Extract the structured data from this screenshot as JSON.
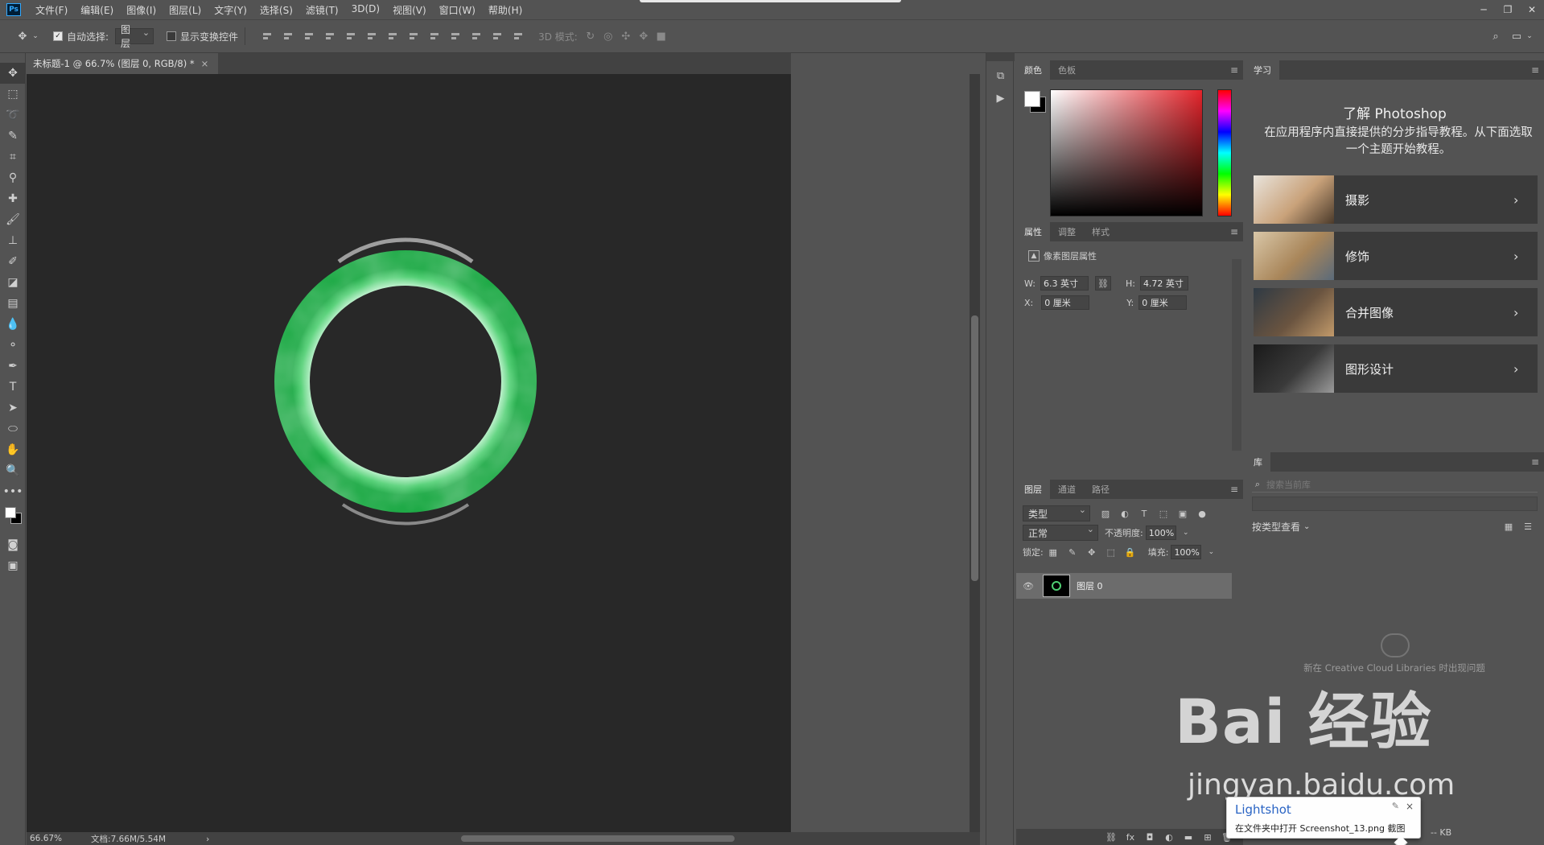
{
  "app": {
    "logo": "Ps"
  },
  "menu": [
    "文件(F)",
    "编辑(E)",
    "图像(I)",
    "图层(L)",
    "文字(Y)",
    "选择(S)",
    "滤镜(T)",
    "3D(D)",
    "视图(V)",
    "窗口(W)",
    "帮助(H)"
  ],
  "options": {
    "auto_select_label": "自动选择:",
    "auto_select_value": "图层",
    "show_transform_label": "显示变换控件",
    "mode_3d_label": "3D 模式:"
  },
  "document": {
    "tab_title": "未标题-1 @ 66.7% (图层 0, RGB/8) *",
    "close_glyph": "×",
    "zoom": "66.67%",
    "doc_info": "文档:7.66M/5.54M",
    "ring_colors": {
      "base": "#4fcf72",
      "light": "#cdf7da",
      "dark": "#1faa47"
    }
  },
  "color_panel": {
    "tabs": [
      "颜色",
      "色板"
    ],
    "fg": "#ffffff",
    "bg": "#000000",
    "hue": "#e3242b"
  },
  "properties_panel": {
    "tabs": [
      "属性",
      "调整",
      "样式"
    ],
    "header": "像素图层属性",
    "w_label": "W:",
    "w_value": "6.3 英寸",
    "h_label": "H:",
    "h_value": "4.72 英寸",
    "x_label": "X:",
    "x_value": "0 厘米",
    "y_label": "Y:",
    "y_value": "0 厘米"
  },
  "layers_panel": {
    "tabs": [
      "图层",
      "通道",
      "路径"
    ],
    "filter_label": "类型",
    "blend_mode": "正常",
    "opacity_label": "不透明度:",
    "opacity_value": "100%",
    "lock_label": "锁定:",
    "fill_label": "填充:",
    "fill_value": "100%",
    "layer_name": "图层 0"
  },
  "learn_panel": {
    "tab": "学习",
    "title": "了解 Photoshop",
    "description": "在应用程序内直接提供的分步指导教程。从下面选取一个主题开始教程。",
    "cards": [
      {
        "label": "摄影",
        "colors": [
          "#e9e4dc",
          "#c9a27a",
          "#4b3a2a"
        ]
      },
      {
        "label": "修饰",
        "colors": [
          "#d9c7a8",
          "#a9865a",
          "#5a6a7a"
        ]
      },
      {
        "label": "合并图像",
        "colors": [
          "#2f3a44",
          "#6a5440",
          "#c29a6a"
        ]
      },
      {
        "label": "图形设计",
        "colors": [
          "#1a1a1a",
          "#3a3a3a",
          "#9a9a9a"
        ]
      }
    ]
  },
  "library_panel": {
    "tab": "库",
    "search_placeholder": "搜索当前库",
    "view_label": "按类型查看",
    "message": "新在 Creative Cloud Libraries 时出现问题",
    "size": "-- KB"
  },
  "watermark": {
    "brand": "Bai 经验",
    "url": "jingyan.baidu.com"
  },
  "lightshot": {
    "title": "Lightshot",
    "text": "在文件夹中打开 Screenshot_13.png 截图",
    "close": "×"
  }
}
